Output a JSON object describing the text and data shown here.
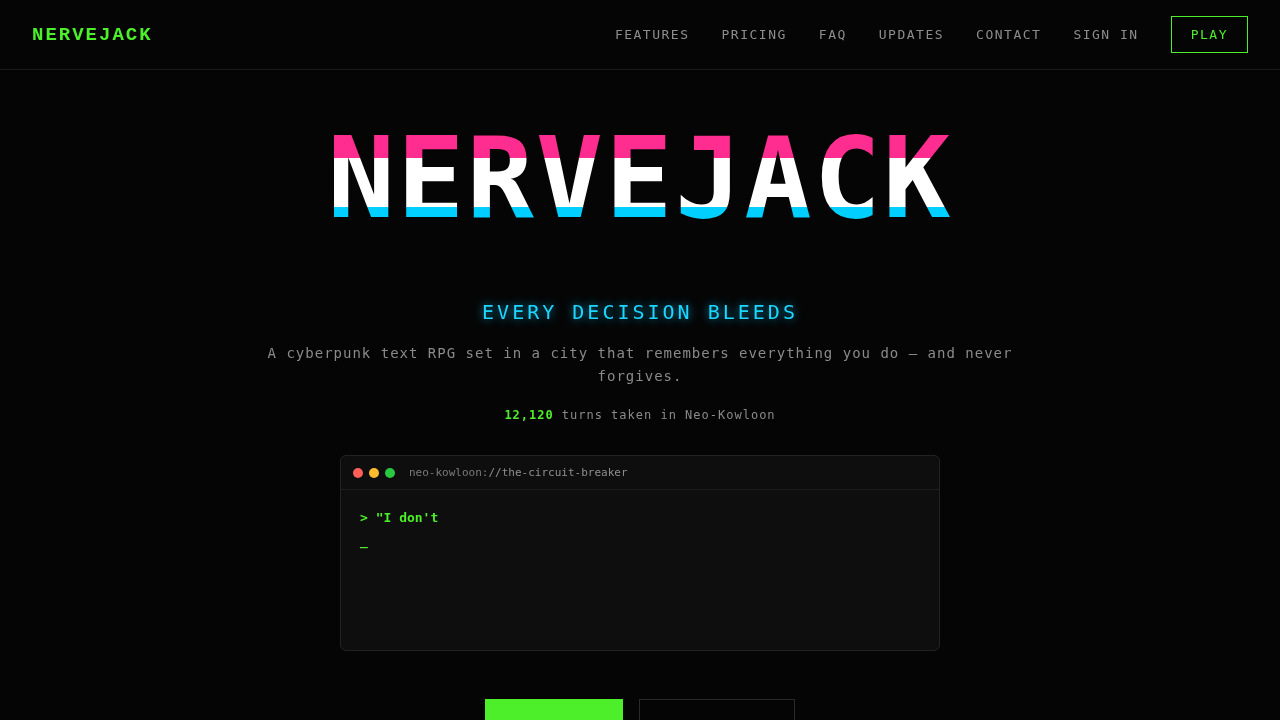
{
  "brand": "NERVEJACK",
  "nav": [
    {
      "label": "FEATURES"
    },
    {
      "label": "PRICING"
    },
    {
      "label": "FAQ"
    },
    {
      "label": "UPDATES"
    },
    {
      "label": "CONTACT"
    },
    {
      "label": "SIGN IN"
    }
  ],
  "play_button": "PLAY",
  "hero": {
    "title": "NERVEJACK",
    "tagline": "EVERY DECISION BLEEDS",
    "description": "A cyberpunk text RPG set in a city that remembers everything you do — and never forgives.",
    "stats": {
      "count": "12,120",
      "label": "turns taken in Neo-Kowloon"
    }
  },
  "terminal": {
    "path_prefix": "neo-kowloon:",
    "path": "//the-circuit-breaker",
    "lines": [
      "> \"I don't"
    ],
    "cursor": "_"
  }
}
